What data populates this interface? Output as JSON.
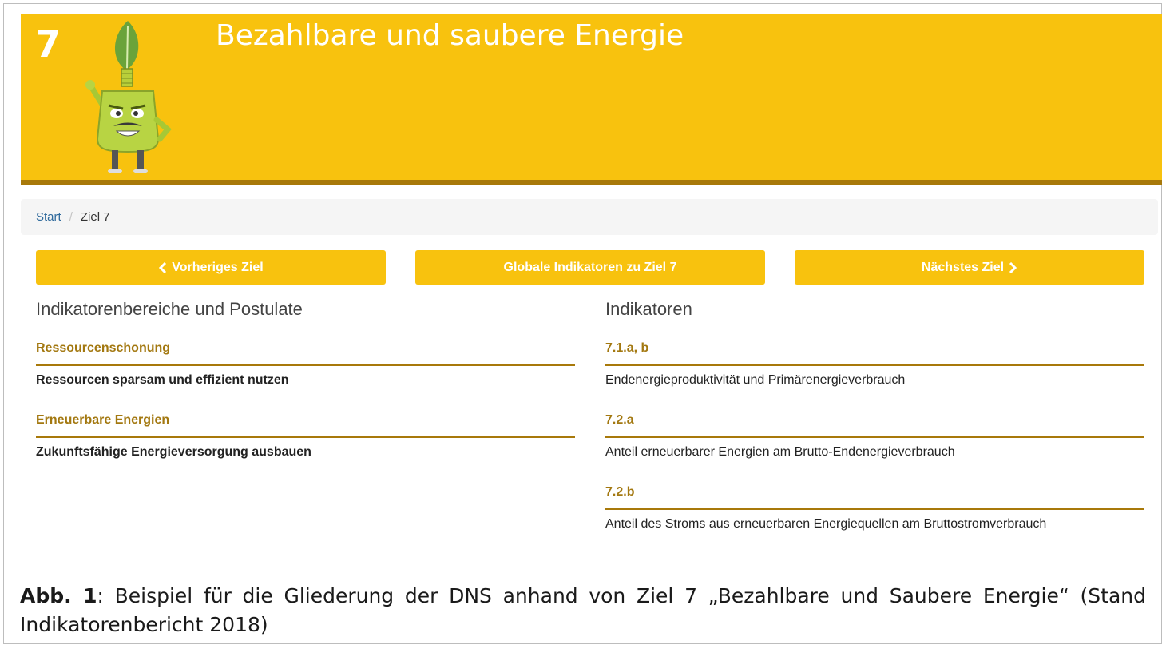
{
  "banner": {
    "goal_number": "7",
    "title": "Bezahlbare und saubere Energie",
    "brand_color": "#f8c20e",
    "accent_color": "#a8790a"
  },
  "breadcrumb": {
    "start": "Start",
    "separator": "/",
    "current": "Ziel 7"
  },
  "nav": {
    "previous_icon": "chevron-left-icon",
    "previous_label": "Vorheriges Ziel",
    "global_label": "Globale Indikatoren zu Ziel 7",
    "next_label": "Nächstes Ziel",
    "next_icon": "chevron-right-icon"
  },
  "left": {
    "heading": "Indikatorenbereiche und Postulate",
    "sections": [
      {
        "title": "Ressourcenschonung",
        "item": "Ressourcen sparsam und effizient nutzen"
      },
      {
        "title": "Erneuerbare Energien",
        "item": "Zukunftsfähige Energieversorgung ausbauen"
      }
    ]
  },
  "right": {
    "heading": "Indikatoren",
    "sections": [
      {
        "title": "7.1.a, b",
        "item": "Endenergieproduktivität und Primärenergieverbrauch"
      },
      {
        "title": "7.2.a",
        "item": "Anteil erneuerbarer Energien am Brutto-Endenergieverbrauch"
      },
      {
        "title": "7.2.b",
        "item": "Anteil des Stroms aus erneuerbaren Energiequellen am Bruttostromverbrauch"
      }
    ]
  },
  "caption": {
    "label": "Abb. 1",
    "text": ": Beispiel für die Gliederung der DNS anhand von Ziel 7 „Bezahlbare und Saubere Energie“ (Stand Indikatorenbericht 2018)"
  }
}
